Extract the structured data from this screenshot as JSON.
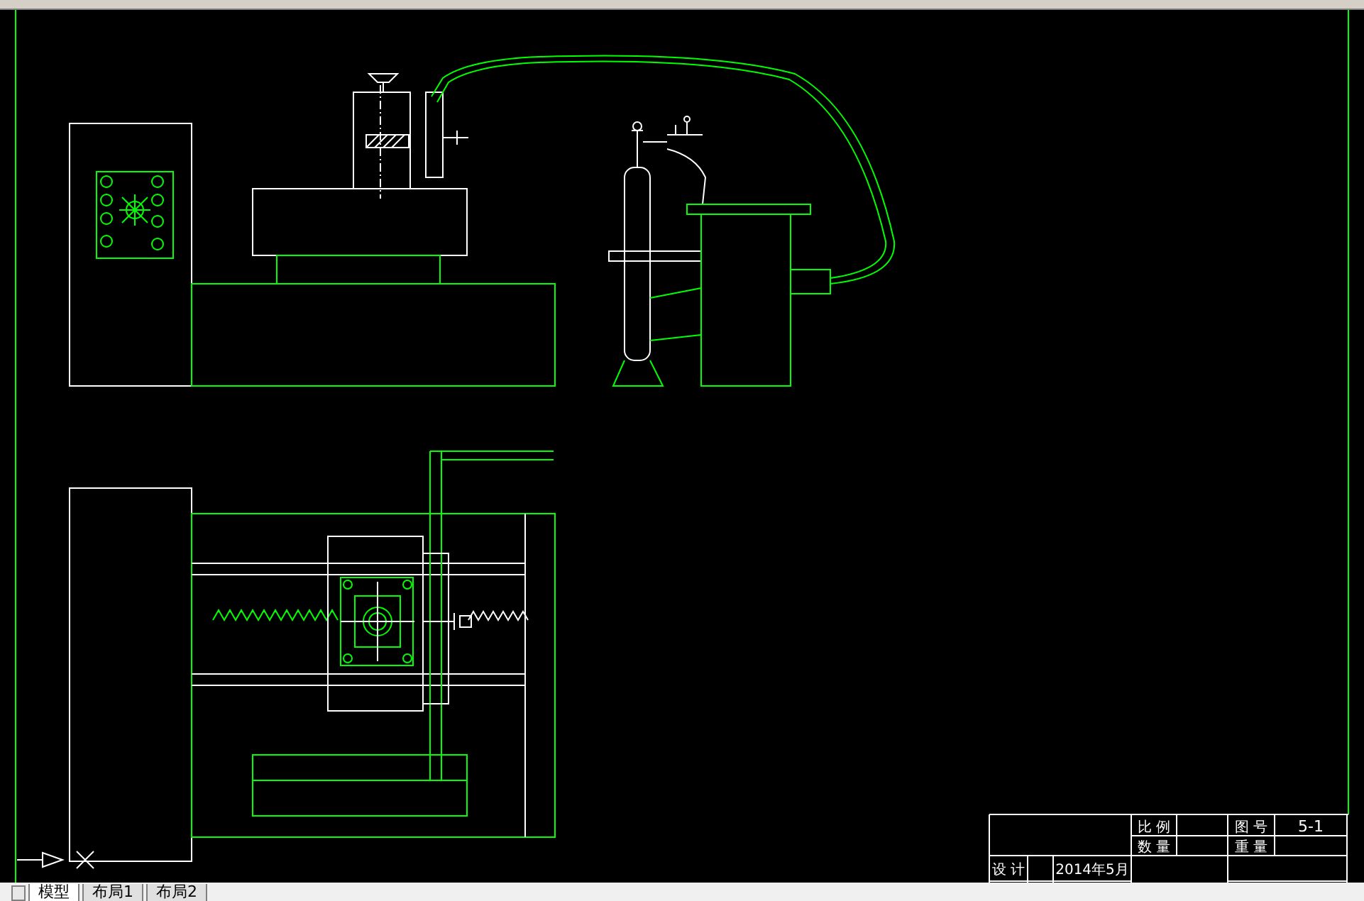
{
  "title_block": {
    "scale_label": "比 例",
    "quantity_label": "数 量",
    "drawing_number_label": "图 号",
    "drawing_number": "5-1",
    "weight_label": "重 量",
    "designer_label": "设 计",
    "date": "2014年5月"
  },
  "layout_tabs": [
    {
      "label": "模型",
      "selected": true
    },
    {
      "label": "布局1",
      "selected": false
    },
    {
      "label": "布局2",
      "selected": false
    }
  ]
}
